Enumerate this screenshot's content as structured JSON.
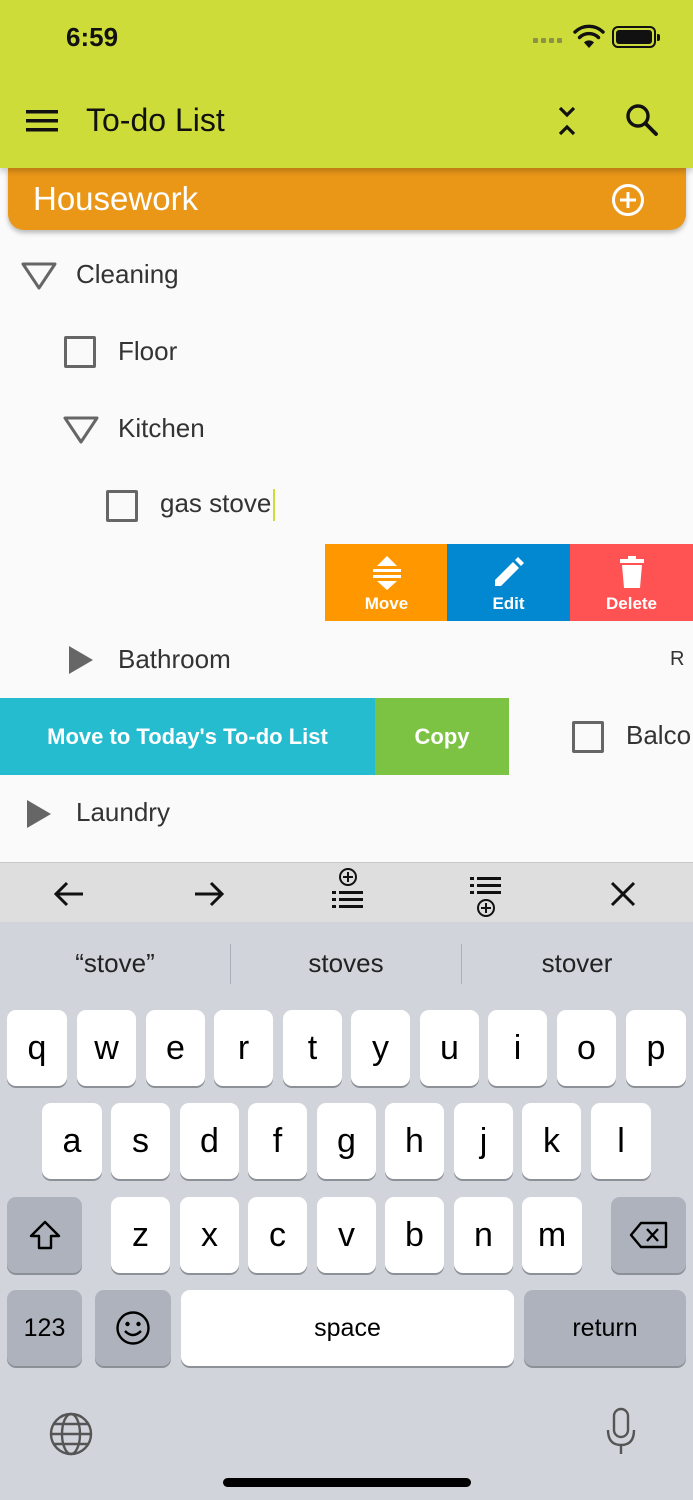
{
  "status_bar": {
    "time": "6:59"
  },
  "appbar": {
    "title": "To-do List",
    "menu_icon": "menu-icon",
    "collapse_icon": "collapse-all-icon",
    "search_icon": "search-icon"
  },
  "category": {
    "title": "Housework",
    "add_icon": "add-circle-icon",
    "color": "#ea9718"
  },
  "tree": {
    "cleaning": "Cleaning",
    "floor": "Floor",
    "kitchen": "Kitchen",
    "gas_stove": "gas stove",
    "bathroom": "Bathroom",
    "bathroom_trailing": "R",
    "balcony": "Balco",
    "laundry": "Laundry"
  },
  "swipe_right_actions": {
    "move": "Move",
    "edit": "Edit",
    "delete": "Delete"
  },
  "swipe_left_actions": {
    "move_today": "Move to Today's To-do List",
    "copy": "Copy"
  },
  "toolbar": {
    "icons": [
      "arrow-left-icon",
      "arrow-right-icon",
      "add-subitem-above-icon",
      "add-subitem-below-icon",
      "close-icon"
    ]
  },
  "keyboard": {
    "suggestions": [
      "“stove”",
      "stoves",
      "stover"
    ],
    "row1": [
      "q",
      "w",
      "e",
      "r",
      "t",
      "y",
      "u",
      "i",
      "o",
      "p"
    ],
    "row2": [
      "a",
      "s",
      "d",
      "f",
      "g",
      "h",
      "j",
      "k",
      "l"
    ],
    "row3": [
      "z",
      "x",
      "c",
      "v",
      "b",
      "n",
      "m"
    ],
    "numbers_key": "123",
    "space_key": "space",
    "return_key": "return"
  },
  "colors": {
    "appbar": "#cddc39",
    "move": "#ff9800",
    "edit": "#0288d1",
    "delete": "#ff5252",
    "move_today": "#26bcd0",
    "copy": "#7cc243"
  }
}
